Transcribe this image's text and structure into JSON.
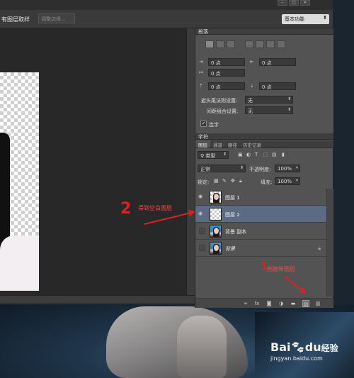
{
  "options_bar": {
    "left_text": "有图层取样",
    "refine_button": "调整边缘...",
    "workspace": "基本功能"
  },
  "paragraph_panel": {
    "title": "段落",
    "indent_left": "0 点",
    "indent_right": "0 点",
    "first_line": "0 点",
    "space_before": "0 点",
    "space_after": "0 点",
    "kinsoku_label": "避头尾法则设置:",
    "kinsoku_value": "无",
    "mojikumi_label": "间距组合设置:",
    "mojikumi_value": "无",
    "hyphenate_label": "连字"
  },
  "character_panel": {
    "title": "字符"
  },
  "layers_panel": {
    "tabs": [
      "图层",
      "通道",
      "路径",
      "历史记录"
    ],
    "filter_kind": "类型",
    "blend_mode": "正常",
    "opacity_label": "不透明度:",
    "opacity_value": "100%",
    "lock_label": "锁定:",
    "fill_label": "填充:",
    "fill_value": "100%",
    "layers": [
      {
        "name": "图层 1",
        "visible": true,
        "selected": false,
        "thumb": "photo-transparent"
      },
      {
        "name": "图层 2",
        "visible": true,
        "selected": true,
        "thumb": "empty"
      },
      {
        "name": "背景 副本",
        "visible": false,
        "selected": false,
        "thumb": "photo"
      },
      {
        "name": "背景",
        "visible": false,
        "selected": false,
        "thumb": "photo",
        "locked": true
      }
    ]
  },
  "annotations": {
    "step2_number": "2",
    "step2_text": "得到空白图层",
    "step1_number": "1",
    "step1_text": "创建新图层"
  },
  "watermark": {
    "logo_left": "Bai",
    "logo_mid": "du",
    "logo_right": "经验",
    "url": "jingyan.baidu.com"
  },
  "colors": {
    "annotation": "#e02020",
    "selected_row": "#5d6a83",
    "panel_bg": "#535353"
  }
}
